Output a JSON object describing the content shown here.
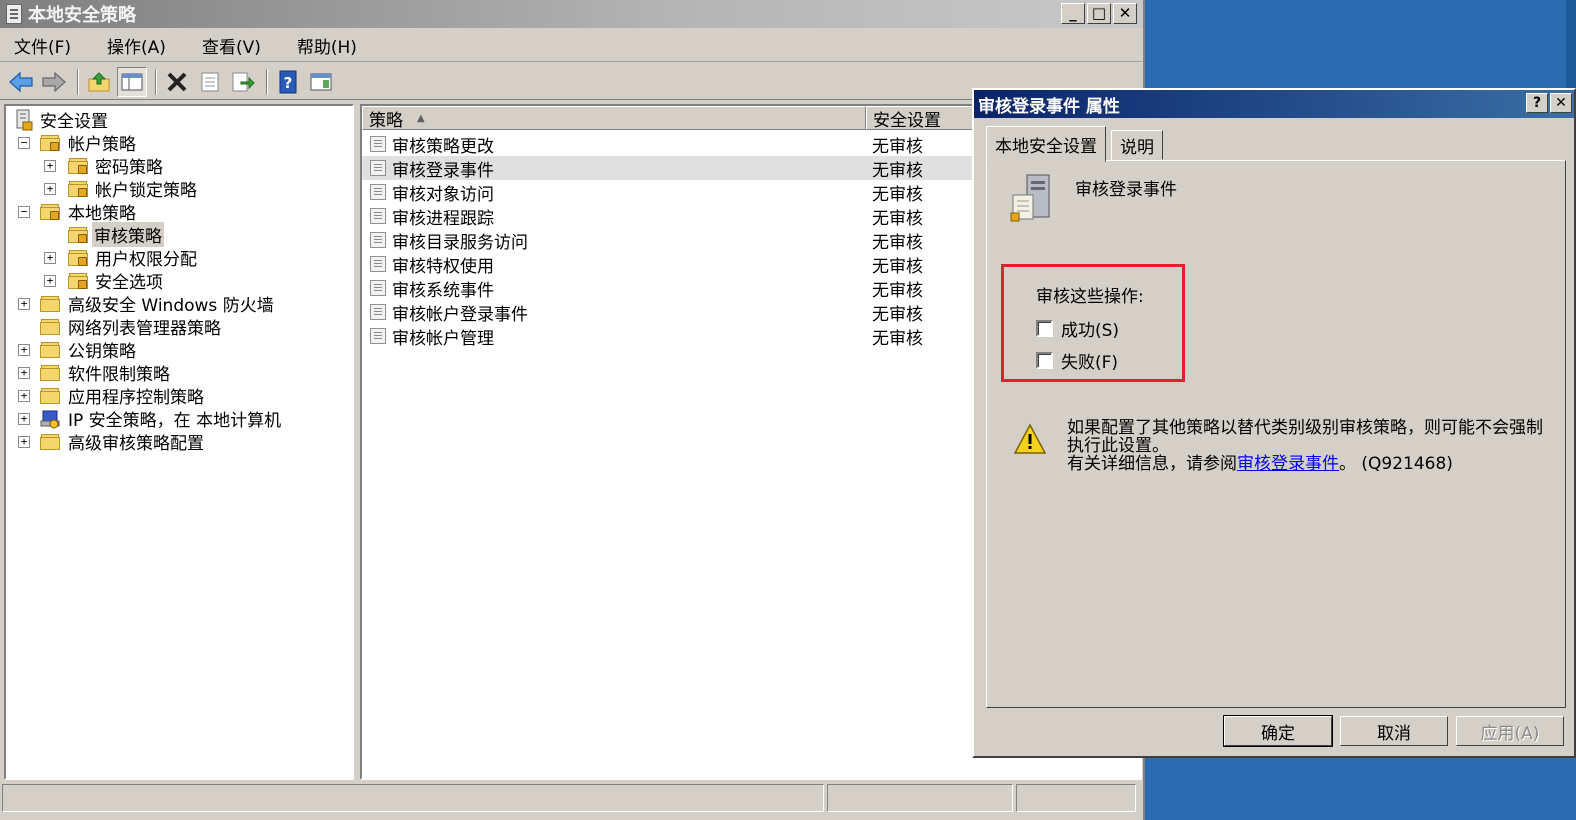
{
  "main_window": {
    "title": "本地安全策略",
    "buttons": {
      "minimize": "_",
      "maximize": "□",
      "close": "✕"
    }
  },
  "menu": [
    "文件(F)",
    "操作(A)",
    "查看(V)",
    "帮助(H)"
  ],
  "tree": {
    "root": "安全设置",
    "items": [
      "帐户策略",
      "密码策略",
      "帐户锁定策略",
      "本地策略",
      "审核策略",
      "用户权限分配",
      "安全选项",
      "高级安全 Windows 防火墙",
      "网络列表管理器策略",
      "公钥策略",
      "软件限制策略",
      "应用程序控制策略",
      "IP 安全策略，在 本地计算机",
      "高级审核策略配置"
    ],
    "expander_collapsed": "+",
    "expander_expanded": "−"
  },
  "list": {
    "columns": [
      "策略",
      "安全设置"
    ],
    "sort_indicator": "▲",
    "rows": [
      {
        "policy": "审核策略更改",
        "setting": "无审核"
      },
      {
        "policy": "审核登录事件",
        "setting": "无审核"
      },
      {
        "policy": "审核对象访问",
        "setting": "无审核"
      },
      {
        "policy": "审核进程跟踪",
        "setting": "无审核"
      },
      {
        "policy": "审核目录服务访问",
        "setting": "无审核"
      },
      {
        "policy": "审核特权使用",
        "setting": "无审核"
      },
      {
        "policy": "审核系统事件",
        "setting": "无审核"
      },
      {
        "policy": "审核帐户登录事件",
        "setting": "无审核"
      },
      {
        "policy": "审核帐户管理",
        "setting": "无审核"
      }
    ]
  },
  "dialog": {
    "title": "审核登录事件 属性",
    "help_btn": "?",
    "close_btn": "✕",
    "tabs": [
      "本地安全设置",
      "说明"
    ],
    "policy_name": "审核登录事件",
    "audit_label": "审核这些操作:",
    "success_label": "成功(S)",
    "failure_label": "失败(F)",
    "success_checked": false,
    "failure_checked": false,
    "warning_line1": "如果配置了其他策略以替代类别级别审核策略，则可能不会强制执行此设置。",
    "warning_line2_prefix": "有关详细信息，请参阅",
    "warning_link": "审核登录事件",
    "warning_line2_suffix": "。 (Q921468)",
    "ok": "确定",
    "cancel": "取消",
    "apply": "应用(A)"
  }
}
